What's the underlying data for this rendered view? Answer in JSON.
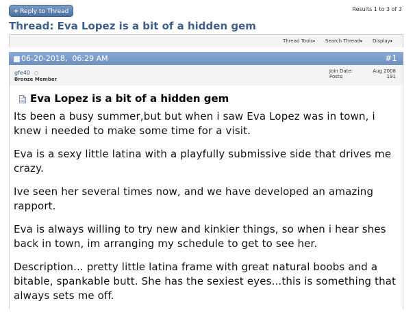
{
  "reply_button": {
    "label": "Reply to Thread",
    "plus": "+"
  },
  "results": "Results 1 to 3 of 3",
  "thread": {
    "prefix": "Thread:",
    "title": "Eva Lopez is a bit of a hidden gem"
  },
  "tools": {
    "thread_tools": "Thread Tools",
    "search_thread": "Search Thread",
    "display": "Display"
  },
  "post": {
    "date": "06-20-2018,  06:29 AM",
    "number": "#1",
    "username": "gfe40",
    "rank": "Bronze Member",
    "join_date_label": "Join Date:",
    "join_date": "Aug 2008",
    "posts_label": "Posts:",
    "posts": "191",
    "title": "Eva Lopez is a bit of a hidden gem",
    "paragraphs": [
      "Its been a busy summer,but but when i saw Eva Lopez was in town, i knew i needed to make some time for a visit.",
      "Eva is a sexy little latina with a playfully submissive side that drives me crazy.",
      "Ive seen her several times now, and we have developed an amazing rapport.",
      "Eva is always willing to try new and kinkier things, so when i hear shes back in town, im arranging my schedule to get to see her.",
      "Description... pretty little latina frame with great natural boobs and a bitable, spankable butt. She has the sexiest eyes...this is something that always sets me off."
    ]
  },
  "colors": {
    "accent": "#3d5f8a",
    "postbar": "#7b9cc8"
  }
}
